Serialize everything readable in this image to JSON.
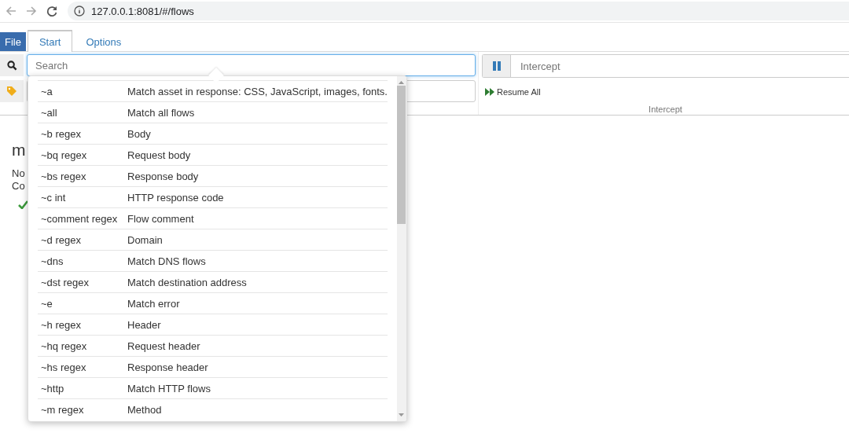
{
  "browser": {
    "url": "127.0.0.1:8081/#/flows"
  },
  "menu": [
    {
      "label": "File",
      "kind": "file"
    },
    {
      "label": "Start",
      "kind": "tab",
      "selected": true
    },
    {
      "label": "Options",
      "kind": "tab",
      "selected": false
    }
  ],
  "search": {
    "placeholder": "Search"
  },
  "intercept": {
    "placeholder": "Intercept",
    "resume_button": "Resume All",
    "group_label": "Intercept"
  },
  "status": {
    "heading": "m",
    "lines": [
      "No",
      "Co"
    ]
  },
  "filter_help": [
    {
      "expr": "~a",
      "desc": "Match asset in response: CSS, JavaScript, images, fonts."
    },
    {
      "expr": "~all",
      "desc": "Match all flows"
    },
    {
      "expr": "~b regex",
      "desc": "Body"
    },
    {
      "expr": "~bq regex",
      "desc": "Request body"
    },
    {
      "expr": "~bs regex",
      "desc": "Response body"
    },
    {
      "expr": "~c int",
      "desc": "HTTP response code"
    },
    {
      "expr": "~comment regex",
      "desc": "Flow comment"
    },
    {
      "expr": "~d regex",
      "desc": "Domain"
    },
    {
      "expr": "~dns",
      "desc": "Match DNS flows"
    },
    {
      "expr": "~dst regex",
      "desc": "Match destination address"
    },
    {
      "expr": "~e",
      "desc": "Match error"
    },
    {
      "expr": "~h regex",
      "desc": "Header"
    },
    {
      "expr": "~hq regex",
      "desc": "Request header"
    },
    {
      "expr": "~hs regex",
      "desc": "Response header"
    },
    {
      "expr": "~http",
      "desc": "Match HTTP flows"
    },
    {
      "expr": "~m regex",
      "desc": "Method"
    }
  ]
}
